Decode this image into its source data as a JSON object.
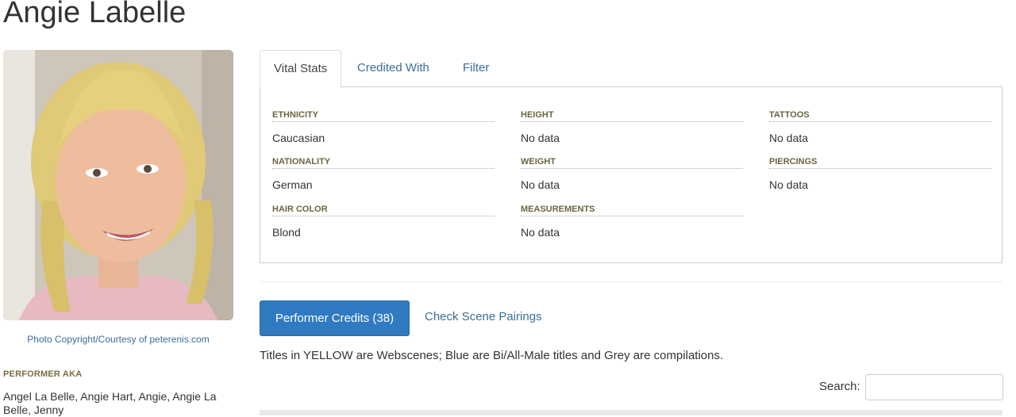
{
  "performer": {
    "name": "Angie Labelle",
    "photo_credit": "Photo Copyright/Courtesy of peterenis.com",
    "aka_heading": "PERFORMER AKA",
    "aka": "Angel La Belle, Angie Hart, Angie, Angie La Belle, Jenny"
  },
  "tabs": [
    {
      "label": "Vital Stats",
      "active": true
    },
    {
      "label": "Credited With",
      "active": false
    },
    {
      "label": "Filter",
      "active": false
    }
  ],
  "vital_stats": {
    "ethnicity": {
      "label": "ETHNICITY",
      "value": "Caucasian"
    },
    "nationality": {
      "label": "NATIONALITY",
      "value": "German"
    },
    "hair_color": {
      "label": "HAIR COLOR",
      "value": "Blond"
    },
    "height": {
      "label": "HEIGHT",
      "value": "No data"
    },
    "weight": {
      "label": "WEIGHT",
      "value": "No data"
    },
    "measurements": {
      "label": "MEASUREMENTS",
      "value": "No data"
    },
    "tattoos": {
      "label": "TATTOOS",
      "value": "No data"
    },
    "piercings": {
      "label": "PIERCINGS",
      "value": "No data"
    }
  },
  "credits": {
    "button_label": "Performer Credits (38)",
    "pairings_link": "Check Scene Pairings",
    "legend_note": "Titles in YELLOW are Webscenes; Blue are Bi/All-Male titles and Grey are compilations.",
    "search_label": "Search:"
  },
  "colors": {
    "link": "#3a6f9a",
    "primary_button": "#2f7ac0",
    "stat_label": "#6b6540"
  }
}
